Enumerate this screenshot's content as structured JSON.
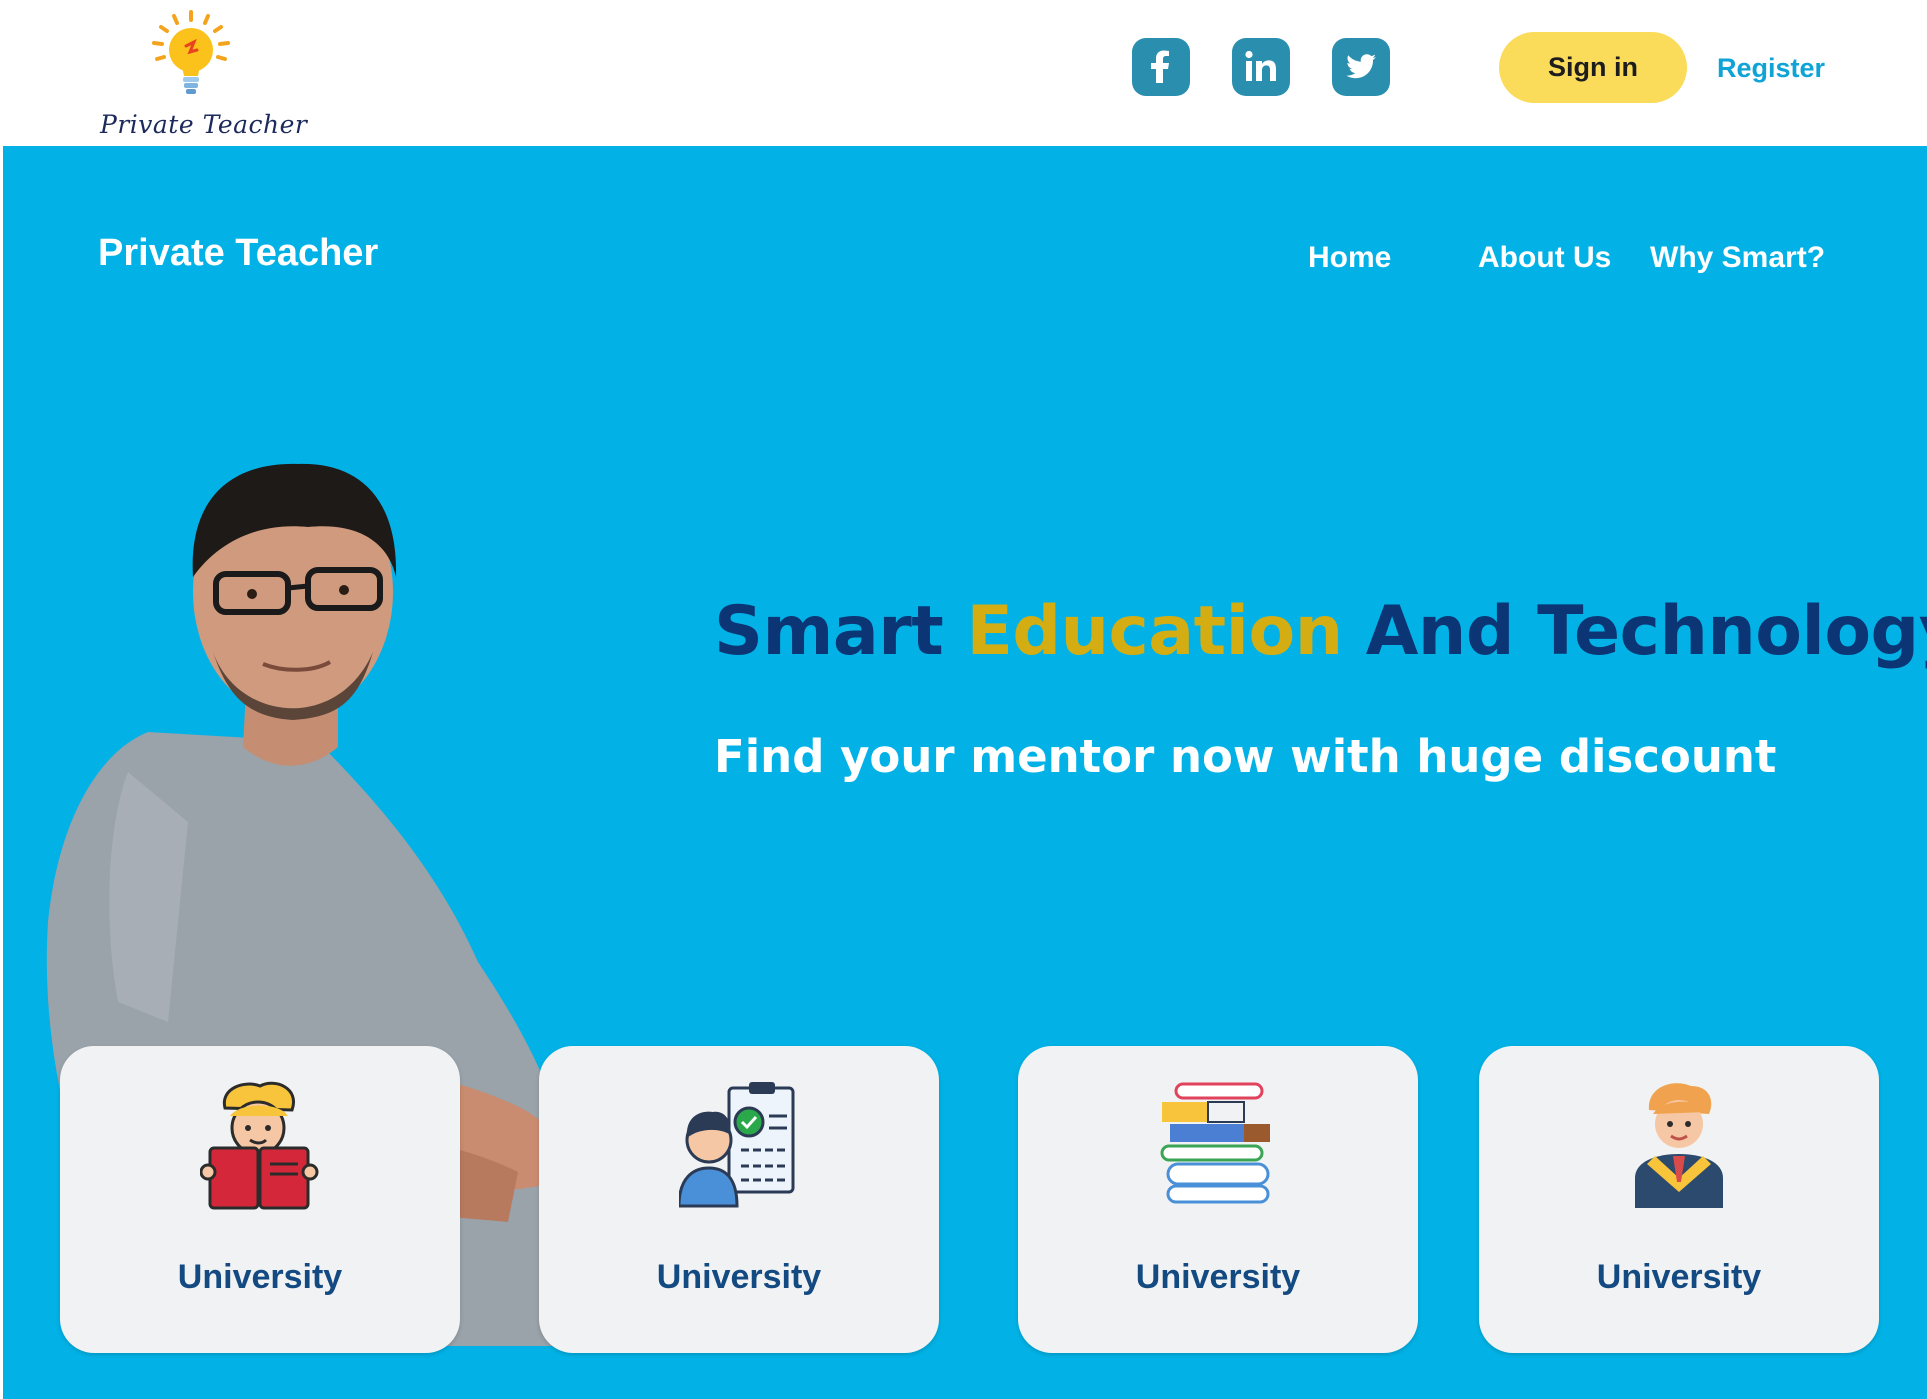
{
  "header": {
    "logo_text": "Private Teacher",
    "social": [
      {
        "name": "facebook-icon"
      },
      {
        "name": "linkedin-icon"
      },
      {
        "name": "twitter-icon"
      }
    ],
    "signin_label": "Sign in",
    "register_label": "Register"
  },
  "hero": {
    "brand": "Private Teacher",
    "nav": {
      "home": "Home",
      "about": "About Us",
      "why": "Why Smart?"
    },
    "headline": {
      "part1": "Smart ",
      "accent": "Education",
      "part2": " And Technology"
    },
    "subline": "Find your mentor now with huge discount"
  },
  "cards": [
    {
      "label": "University",
      "icon": "reading-student-icon"
    },
    {
      "label": "University",
      "icon": "checklist-person-icon"
    },
    {
      "label": "University",
      "icon": "books-stack-icon"
    },
    {
      "label": "University",
      "icon": "graduate-icon"
    }
  ],
  "colors": {
    "hero_bg": "#02b2e6",
    "headline": "#0b3574",
    "headline_accent": "#d4ad12",
    "signin_bg": "#fbdb5a",
    "register_text": "#0fa3d6",
    "social_bg": "#2a8fae",
    "card_bg": "#f1f2f3",
    "card_label": "#134a82"
  }
}
